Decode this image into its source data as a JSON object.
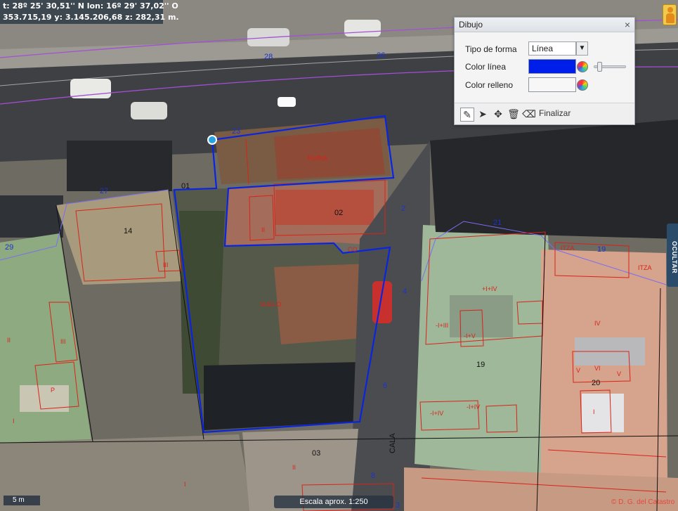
{
  "coords": {
    "line1": "t: 28º 25' 30,51'' N  lon: 16º 29' 37,02'' O",
    "line2": "353.715,19  y: 3.145.206,68  z: 282,31 m."
  },
  "panel": {
    "title": "Dibujo",
    "close": "×",
    "shape_label": "Tipo de forma",
    "shape_value": "Línea",
    "line_color_label": "Color línea",
    "line_color": "#001eea",
    "fill_color_label": "Color relleno",
    "fill_color": "#f7f7f7",
    "finalize_label": "Finalizar",
    "tools": [
      "pencil-icon",
      "pointer-icon",
      "move-icon",
      "trash-icon",
      "eraser-icon"
    ]
  },
  "side_tab": "OCULTAR",
  "scale": {
    "bar_label": "5 m",
    "text": "Escala aprox. 1:250"
  },
  "copyright": "© D. G. del Catastro",
  "map_labels": {
    "street_numbers": [
      "28",
      "26",
      "23",
      "27",
      "29",
      "21",
      "19",
      "2",
      "4",
      "6",
      "8",
      "3",
      "9"
    ],
    "parcels": [
      "01",
      "02",
      "03",
      "14",
      "19",
      "20"
    ],
    "red_labels": [
      "RUINA",
      "SUELO",
      "CO",
      "II",
      "III",
      "I",
      "P",
      "IV",
      "V",
      "VI",
      "-I+III",
      "-I+IV",
      "-I+V",
      "+I+IV",
      "ITZA"
    ],
    "street_name": "CALA"
  },
  "colors": {
    "selection": "#0b24e0",
    "parcel_line": "#d8231a",
    "street_line": "#a34fd6",
    "panel_bg": "#f4f4f4"
  }
}
